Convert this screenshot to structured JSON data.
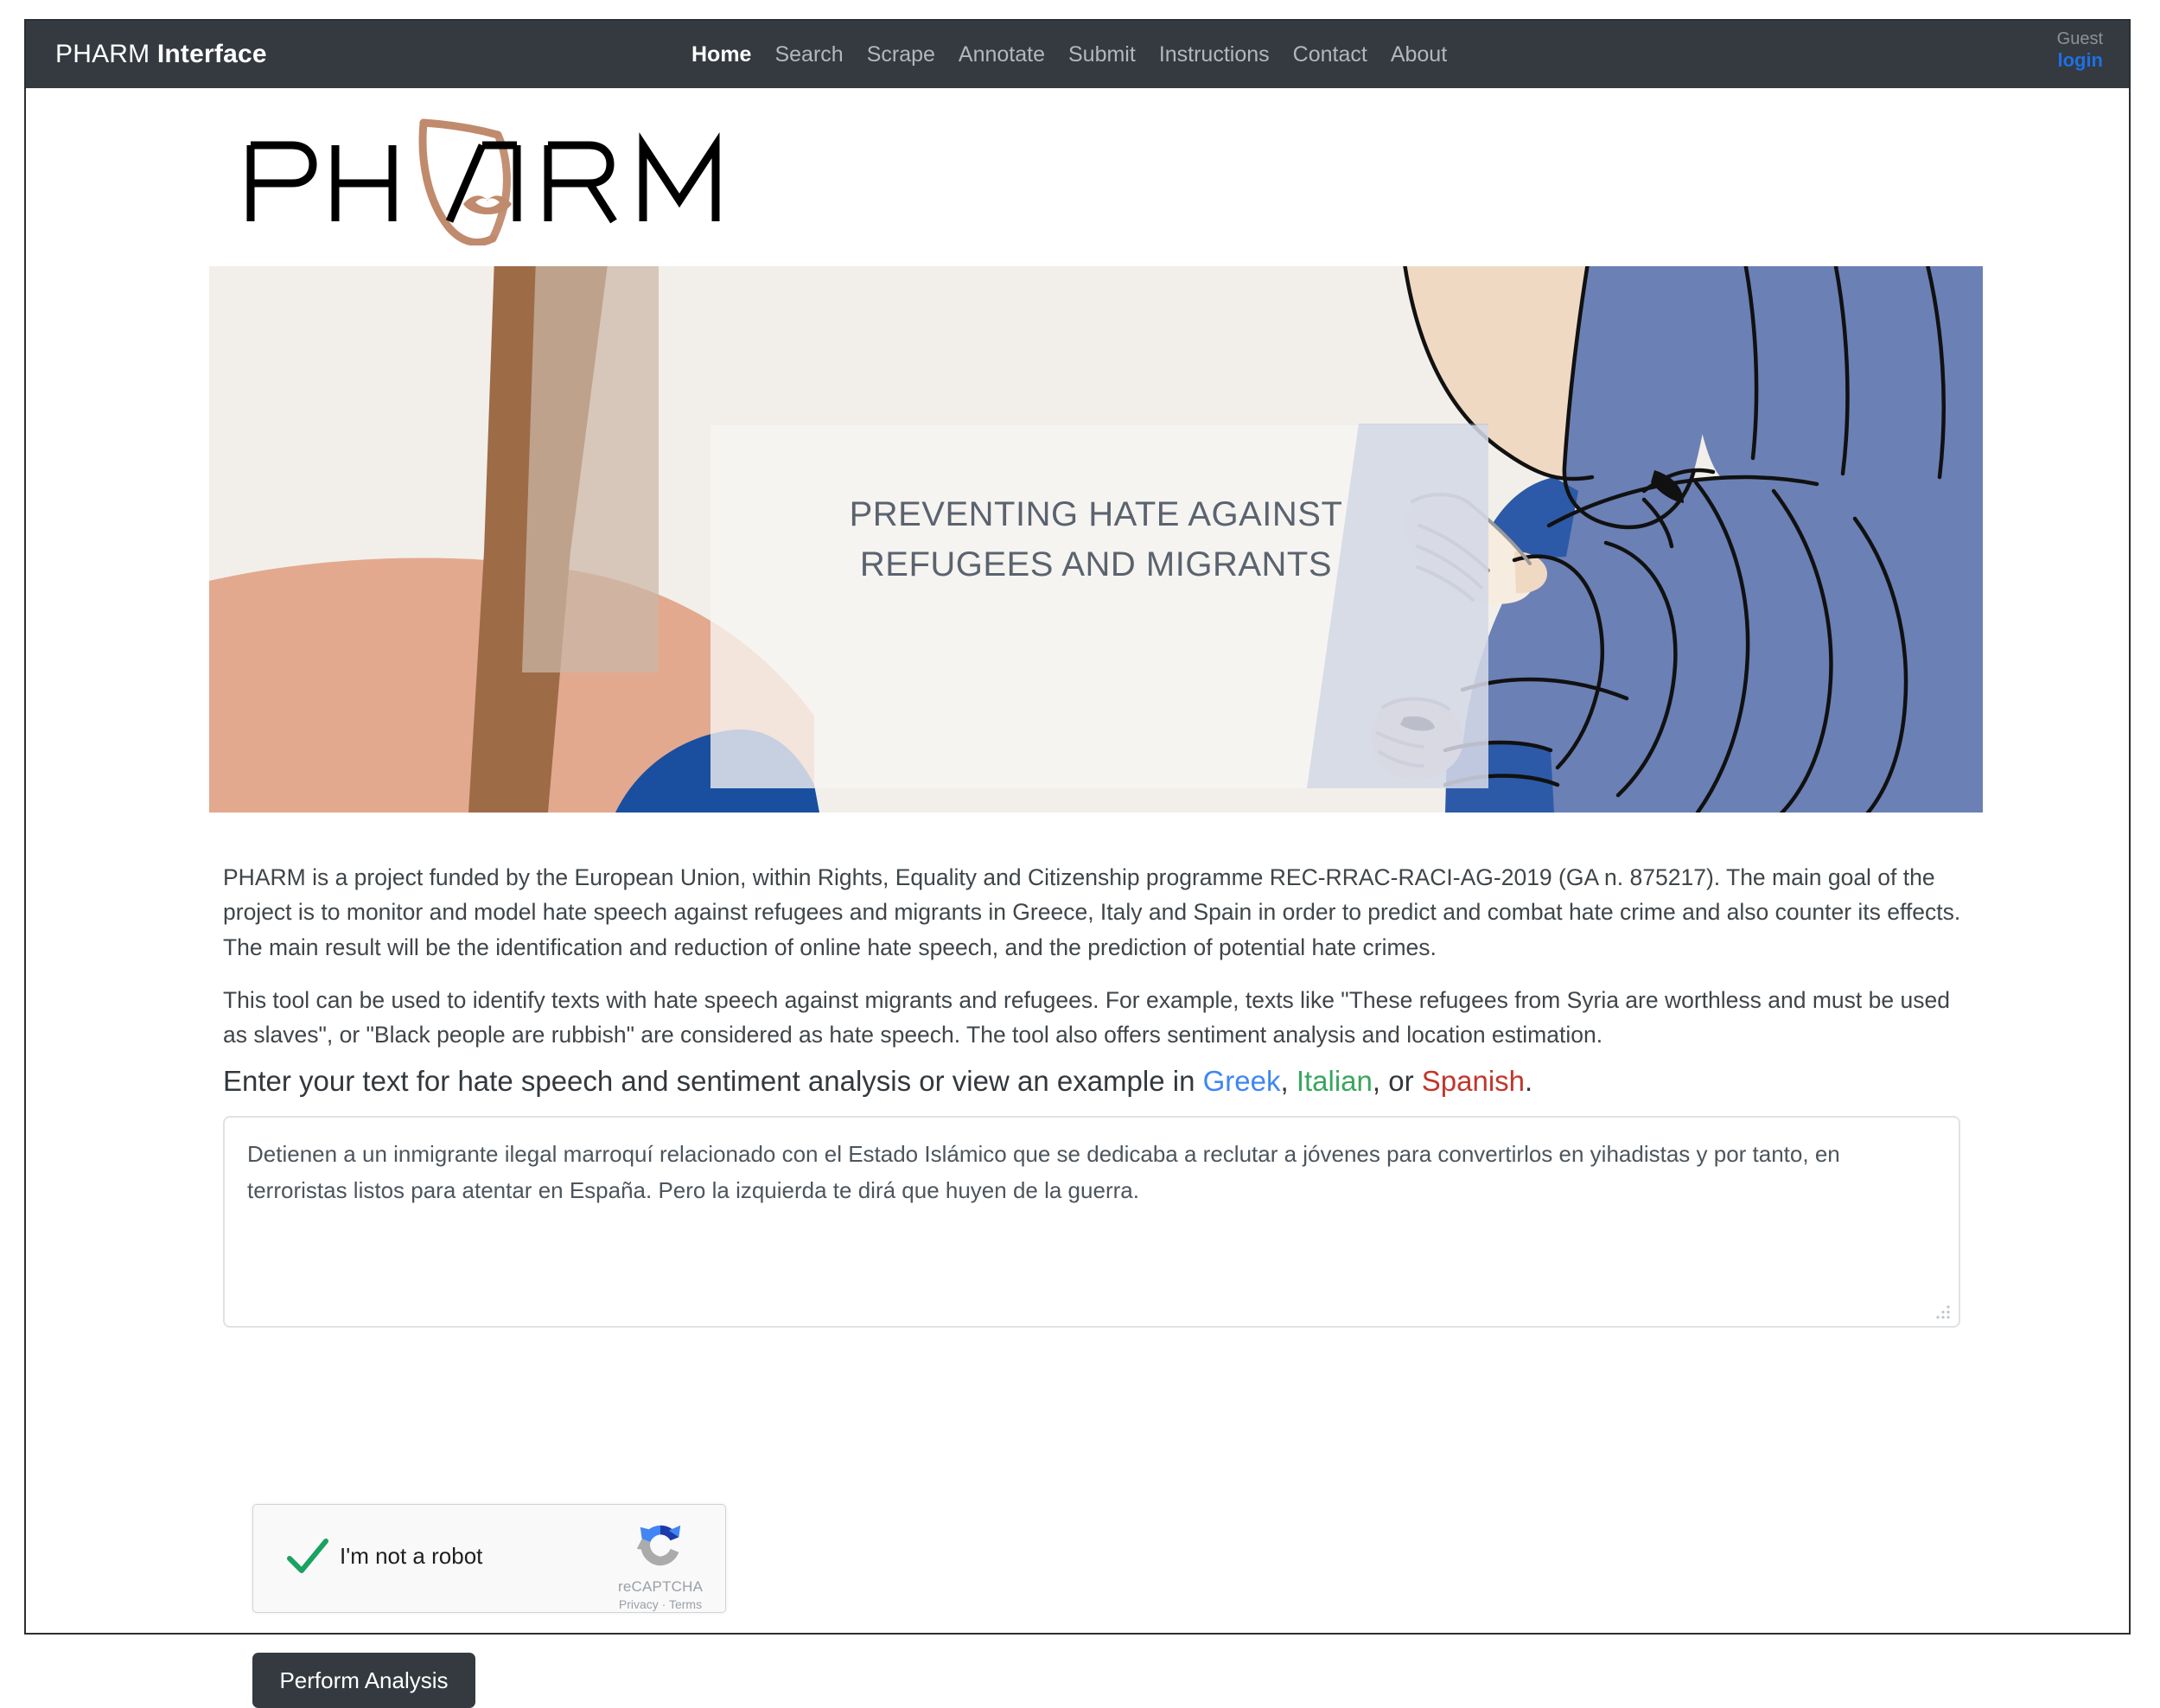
{
  "navbar": {
    "brand_prefix": "PHARM ",
    "brand_suffix": "Interface",
    "links": [
      {
        "label": "Home",
        "active": true
      },
      {
        "label": "Search",
        "active": false
      },
      {
        "label": "Scrape",
        "active": false
      },
      {
        "label": "Annotate",
        "active": false
      },
      {
        "label": "Submit",
        "active": false
      },
      {
        "label": "Instructions",
        "active": false
      },
      {
        "label": "Contact",
        "active": false
      },
      {
        "label": "About",
        "active": false
      }
    ],
    "user": {
      "name": "Guest",
      "login_label": "login"
    },
    "colors": {
      "background": "#343a40",
      "link": "#b3b7bb",
      "active_link": "#ffffff",
      "login": "#1f6fe5"
    }
  },
  "logo": {
    "wordmark": "PHARM",
    "accent_color": "#c08a6d"
  },
  "banner": {
    "caption_line_1": "PREVENTING HATE AGAINST",
    "caption_line_2": "REFUGEES AND MIGRANTS",
    "caption_color": "#5a636e",
    "colors": {
      "background": "#f2efea",
      "skin_light": "#f0d9c3",
      "skin_peach": "#e3a98f",
      "skin_brown": "#9e6b47",
      "skin_tan": "#cbb7a8",
      "garment_blue": "#6b80b5",
      "garment_blue_dark": "#2d5aa8",
      "garment_blue_deep": "#1a4fa0",
      "outline": "#111111",
      "overlay_white": "#f7f5f2"
    }
  },
  "main": {
    "paragraph_1": "PHARM is a project funded by the European Union, within Rights, Equality and Citizenship programme REC-RRAC-RACI-AG-2019 (GA n. 875217). The main goal of the project is to monitor and model hate speech against refugees and migrants in Greece, Italy and Spain in order to predict and combat hate crime and also counter its effects. The main result will be the identification and reduction of online hate speech, and the prediction of potential hate crimes.",
    "paragraph_2": "This tool can be used to identify texts with hate speech against migrants and refugees. For example, texts like \"These refugees from Syria are worthless and must be used as slaves\", or \"Black people are rubbish\" are considered as hate speech. The tool also offers sentiment analysis and location estimation.",
    "heading": {
      "prefix": "Enter your text for hate speech and sentiment analysis or view an example in ",
      "link_greek": "Greek",
      "sep_1": ", ",
      "link_italian": "Italian",
      "sep_2": ", or ",
      "link_spanish": "Spanish",
      "suffix": ".",
      "colors": {
        "greek": "#3e86f5",
        "italian": "#3aa55d",
        "spanish": "#c2362c"
      }
    },
    "text_input": {
      "value": "Detienen a un inmigrante ilegal marroquí relacionado con el Estado Islámico que se dedicaba a reclutar a jóvenes para convertirlos en yihadistas y por tanto, en terroristas listos para atentar en España. Pero la izquierda te dirá que huyen de la guerra.",
      "placeholder": ""
    },
    "recaptcha": {
      "label": "I'm not a robot",
      "brand": "reCAPTCHA",
      "legal": "Privacy · Terms",
      "checked": true
    },
    "submit_button": "Perform Analysis"
  }
}
